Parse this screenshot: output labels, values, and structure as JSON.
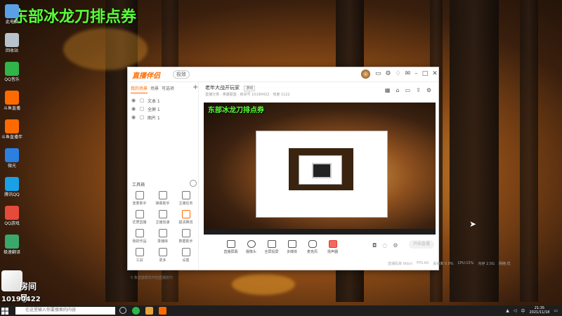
{
  "overlay": {
    "title": "东部冰龙刀排点券"
  },
  "desktop_icons": [
    {
      "label": "此电脑",
      "color": "#5aa0e6"
    },
    {
      "label": "回收站",
      "color": "#b8c2cc"
    },
    {
      "label": "QQ音乐",
      "color": "#2fb54a"
    },
    {
      "label": "斗鱼直播",
      "color": "#ff6a00"
    },
    {
      "label": "斗鱼直播伴侣",
      "color": "#ff6a00"
    },
    {
      "label": "微光",
      "color": "#2b7fe0"
    },
    {
      "label": "腾讯QQ",
      "color": "#1aa0e6"
    },
    {
      "label": "QQ游戏",
      "color": "#e64a3b"
    },
    {
      "label": "极速翻译",
      "color": "#3aa86a"
    }
  ],
  "streamer_badge": {
    "room_label": "房间号",
    "room_number": "10190422"
  },
  "app": {
    "logo": "直播伴侣",
    "version_badge": "极致",
    "titlebar_icons": [
      "chat-icon",
      "settings-icon",
      "bell-icon",
      "mail-icon",
      "minimize-icon",
      "maximize-icon",
      "close-icon"
    ],
    "sidebar": {
      "tabs": [
        "我的场景",
        "场景",
        "可选项"
      ],
      "scenes": [
        {
          "name": "文本 1"
        },
        {
          "name": "全屏 1"
        },
        {
          "name": "图片 1"
        }
      ],
      "tools_heading": "工具箱",
      "tools": [
        {
          "label": "连麦助手"
        },
        {
          "label": "弹幕助手"
        },
        {
          "label": "主播任务"
        },
        {
          "label": "优质直播"
        },
        {
          "label": "主播加速"
        },
        {
          "label": "超清推流"
        },
        {
          "label": "我的作品"
        },
        {
          "label": "录播库"
        },
        {
          "label": "数据助手"
        },
        {
          "label": "工具"
        },
        {
          "label": "更多"
        },
        {
          "label": "设置"
        }
      ],
      "footer": "5 条直播帮你开拓直播技巧"
    },
    "main": {
      "room_title": "老年大战开玩家",
      "room_tag": "游戏",
      "room_meta": "直播分类 · 英雄联盟 · 房间号 10190422 · 热度 1122",
      "preview_title": "东部冰龙刀排点券",
      "controls": [
        {
          "label": "直播屏幕"
        },
        {
          "label": "摄像头"
        },
        {
          "label": "全屏投屏"
        },
        {
          "label": "多媒体"
        },
        {
          "label": "麦克风"
        },
        {
          "label": "扬声器"
        }
      ],
      "start_button": "开始直播",
      "status": [
        "直播码率 0kb/s",
        "FPS:60",
        "丢帧率 0.0%",
        "CPU:15%",
        "内存 2.5G",
        "网络:优"
      ]
    }
  },
  "taskbar": {
    "search_placeholder": "在这里输入你要搜索的内容",
    "time": "21:35",
    "date": "2021/11/18"
  }
}
